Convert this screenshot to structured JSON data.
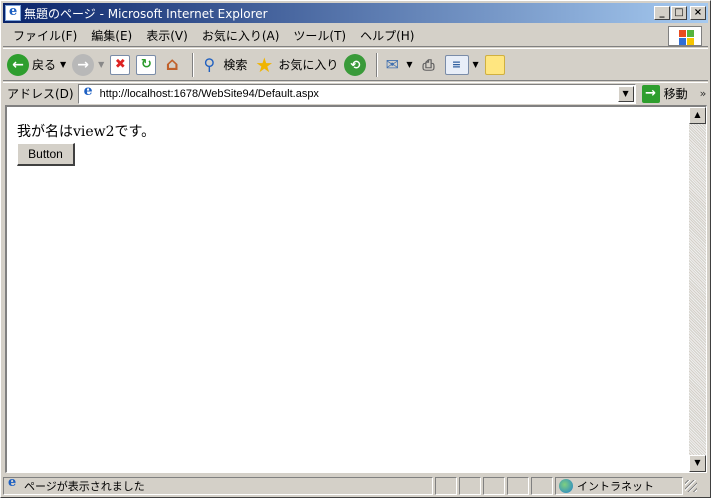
{
  "window": {
    "title": "無題のページ - Microsoft Internet Explorer"
  },
  "menu": {
    "items": [
      {
        "label": "ファイル(F)"
      },
      {
        "label": "編集(E)"
      },
      {
        "label": "表示(V)"
      },
      {
        "label": "お気に入り(A)"
      },
      {
        "label": "ツール(T)"
      },
      {
        "label": "ヘルプ(H)"
      }
    ]
  },
  "toolbar": {
    "back_label": "戻る",
    "search_label": "検索",
    "favorites_label": "お気に入り"
  },
  "address": {
    "label": "アドレス(D)",
    "url": "http://localhost:1678/WebSite94/Default.aspx",
    "go_label": "移動",
    "links_chevron": "»"
  },
  "page": {
    "text": "我が名はview2です。",
    "button_label": "Button"
  },
  "status": {
    "text": "ページが表示されました",
    "zone": "イントラネット"
  },
  "colors": {
    "title_start": "#0a246a",
    "title_end": "#a6caf0",
    "chrome": "#d4d0c8"
  }
}
